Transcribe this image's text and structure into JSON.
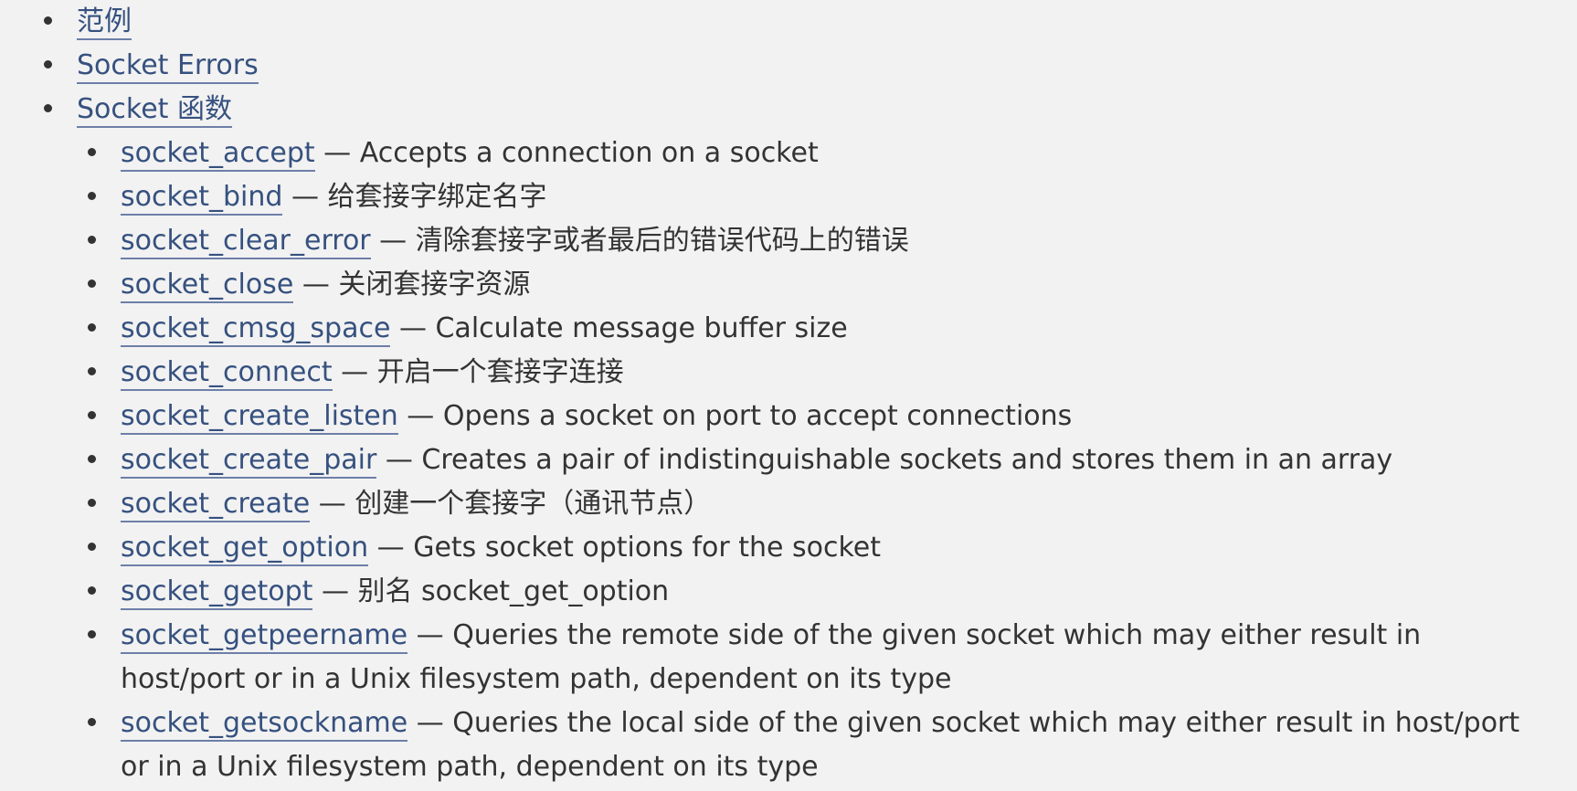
{
  "top_items": [
    {
      "label": "范例"
    },
    {
      "label": "Socket Errors"
    },
    {
      "label": "Socket 函数"
    }
  ],
  "socket_functions": [
    {
      "name": "socket_accept",
      "desc": "Accepts a connection on a socket"
    },
    {
      "name": "socket_bind",
      "desc": "给套接字绑定名字"
    },
    {
      "name": "socket_clear_error",
      "desc": "清除套接字或者最后的错误代码上的错误"
    },
    {
      "name": "socket_close",
      "desc": "关闭套接字资源"
    },
    {
      "name": "socket_cmsg_space",
      "desc": "Calculate message buffer size"
    },
    {
      "name": "socket_connect",
      "desc": "开启一个套接字连接"
    },
    {
      "name": "socket_create_listen",
      "desc": "Opens a socket on port to accept connections"
    },
    {
      "name": "socket_create_pair",
      "desc": "Creates a pair of indistinguishable sockets and stores them in an array"
    },
    {
      "name": "socket_create",
      "desc": "创建一个套接字（通讯节点）"
    },
    {
      "name": "socket_get_option",
      "desc": "Gets socket options for the socket"
    },
    {
      "name": "socket_getopt",
      "desc": "别名 socket_get_option"
    },
    {
      "name": "socket_getpeername",
      "desc": "Queries the remote side of the given socket which may either result in host/port or in a Unix filesystem path, dependent on its type"
    },
    {
      "name": "socket_getsockname",
      "desc": "Queries the local side of the given socket which may either result in host/port or in a Unix filesystem path, dependent on its type"
    }
  ],
  "separator": " — ",
  "colors": {
    "link": "#36517f",
    "text": "#333333",
    "background": "#f2f2f2"
  }
}
